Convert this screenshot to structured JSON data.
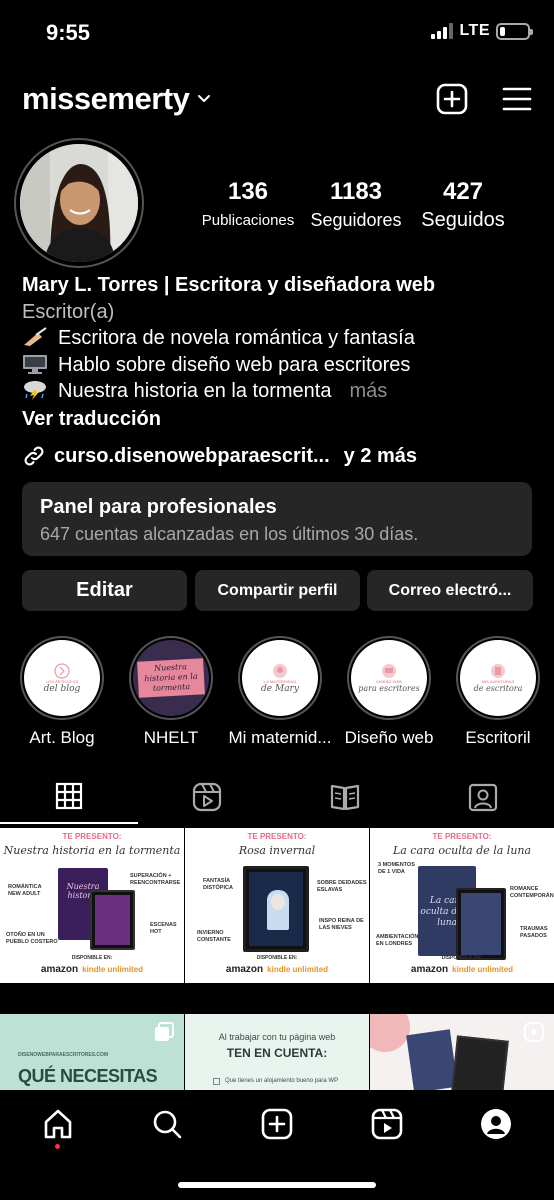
{
  "status_bar": {
    "time": "9:55",
    "network": "LTE"
  },
  "header": {
    "username": "missemerty",
    "icons": [
      "chevron-down-icon",
      "new-post-icon",
      "menu-icon"
    ]
  },
  "stats": [
    {
      "value": "136",
      "label": "Publicaciones"
    },
    {
      "value": "1183",
      "label": "Seguidores"
    },
    {
      "value": "427",
      "label": "Seguidos"
    }
  ],
  "bio": {
    "name": "Mary L. Torres | Escritora y diseñadora web",
    "category": "Escritor(a)",
    "lines": [
      {
        "icon": "writing-hand-icon",
        "text": "Escritora de novela romántica y fantasía"
      },
      {
        "icon": "desktop-computer-icon",
        "text": "Hablo sobre diseño web para escritores"
      },
      {
        "icon": "thunder-cloud-icon",
        "text": "Nuestra historia en la tormenta"
      }
    ],
    "more": "más",
    "translate": "Ver traducción",
    "link": "curso.disenowebparaescrit...",
    "link_more": "y 2 más"
  },
  "pro_panel": {
    "title": "Panel para profesionales",
    "subtitle": "647 cuentas alcanzadas en los últimos 30 días."
  },
  "buttons": {
    "edit": "Editar",
    "share": "Compartir perfil",
    "email": "Correo electró..."
  },
  "highlights": [
    {
      "label": "Art. Blog",
      "art": "del blog",
      "small": "LOS ARTÍCULOS"
    },
    {
      "label": "NHELT",
      "art": "Nuestra historia en la tormenta",
      "small": ""
    },
    {
      "label": "Mi maternid...",
      "art": "de Mary",
      "small": "LA MATERNIDAD"
    },
    {
      "label": "Diseño web",
      "art": "para escritores",
      "small": "DISEÑO WEB"
    },
    {
      "label": "Escritoril",
      "art": "de escritora",
      "small": "MIS AVENTURAS"
    }
  ],
  "tabs": [
    "grid-icon",
    "reels-icon",
    "guides-icon",
    "tagged-icon"
  ],
  "posts": [
    {
      "presents": "TE PRESENTO:",
      "title": "Nuestra historia en la tormenta",
      "book_title": "Nuestra historia",
      "tags": [
        "ROMÁNTICA NEW ADULT",
        "SUPERACIÓN + REENCONTRARSE",
        "ESCENAS HOT",
        "OTOÑO EN UN PUEBLO COSTERO"
      ],
      "available": "DISPONIBLE EN:",
      "store": "amazon",
      "kindle": "kindle unlimited",
      "colors": {
        "book": "#3a1f5c",
        "accent": "#d94a8c"
      }
    },
    {
      "presents": "TE PRESENTO:",
      "title": "Rosa invernal",
      "book_title": "Rosa invernal",
      "tags": [
        "FANTASÍA DISTÓPICA",
        "SOBRE DEIDADES ESLAVAS",
        "INVIERNO CONSTANTE",
        "INSPO REINA DE LAS NIEVES"
      ],
      "available": "DISPONIBLE EN:",
      "store": "amazon",
      "kindle": "kindle unlimited",
      "colors": {
        "book": "#1a2b4a",
        "accent": "#a8c8e8"
      }
    },
    {
      "presents": "TE PRESENTO:",
      "title": "La cara oculta de la luna",
      "book_title": "La cara oculta de la luna",
      "tags": [
        "3 MOMENTOS DE 1 VIDA",
        "ROMANCE CONTEMPORÁNEO",
        "TRAUMAS PASADOS",
        "AMBIENTACIÓN EN LONDRES"
      ],
      "available": "DISPONIBLE EN:",
      "store": "amazon",
      "kindle": "kindle unlimited",
      "colors": {
        "book": "#2f3b63",
        "accent": "#8a9bd0"
      }
    },
    {
      "site": "DISENOWEBPARAESCRITORES.COM",
      "headline": "QUÉ NECESITAS"
    },
    {
      "intro": "Al trabajar con tu página web",
      "headline": "TEN EN CUENTA:",
      "item": "Que tienes un alojamiento bueno para WP"
    },
    {
      "kind": "book-photo"
    }
  ],
  "bottom_nav": [
    "home-icon",
    "search-icon",
    "create-icon",
    "reels-nav-icon",
    "profile-icon"
  ],
  "colors": {
    "background": "#000000",
    "panel": "#262626",
    "notification": "#ff3040"
  }
}
